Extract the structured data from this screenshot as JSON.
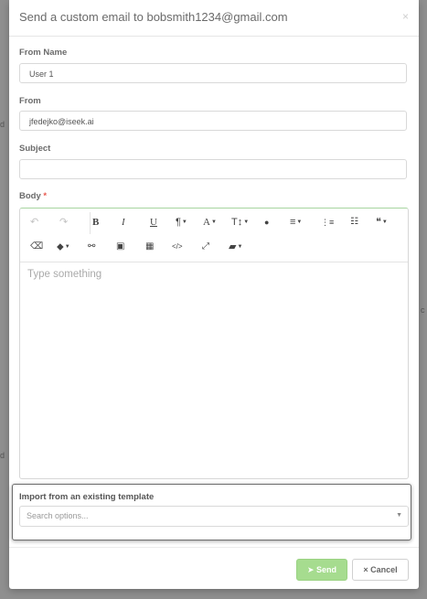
{
  "backdrop": {
    "left_char_a": "d",
    "left_char_b": "d",
    "right_char": "c"
  },
  "modal": {
    "title": "Send a custom email to bobsmith1234@gmail.com",
    "close_glyph": "×"
  },
  "form": {
    "from_name_label": "From Name",
    "from_name_value": "User 1",
    "from_label": "From",
    "from_value": "jfedejko@iseek.ai",
    "subject_label": "Subject",
    "subject_value": "",
    "body_label": "Body",
    "required_mark": "*"
  },
  "editor": {
    "placeholder": "Type something",
    "toolbar_glyphs": {
      "undo": "↶",
      "redo": "↷",
      "bold": "B",
      "italic": "I",
      "underline": "U",
      "paragraph": "¶",
      "font": "A",
      "font_size": "T↕",
      "color": "●",
      "align": "≡",
      "ordered_list": "⋮≡",
      "unordered_list": "☷",
      "quote": "❝",
      "eraser": "⌫",
      "tag": "⬥",
      "link": "⚯",
      "image": "▣",
      "table": "▦",
      "code": "</>",
      "fullscreen": "⤢",
      "template": "▰",
      "caret": "▼"
    }
  },
  "template": {
    "label": "Import from an existing template",
    "placeholder": "Search options...",
    "caret": "▼"
  },
  "footer": {
    "send_label": "Send",
    "send_icon": "➤",
    "cancel_label": "Cancel",
    "cancel_icon": "×"
  }
}
